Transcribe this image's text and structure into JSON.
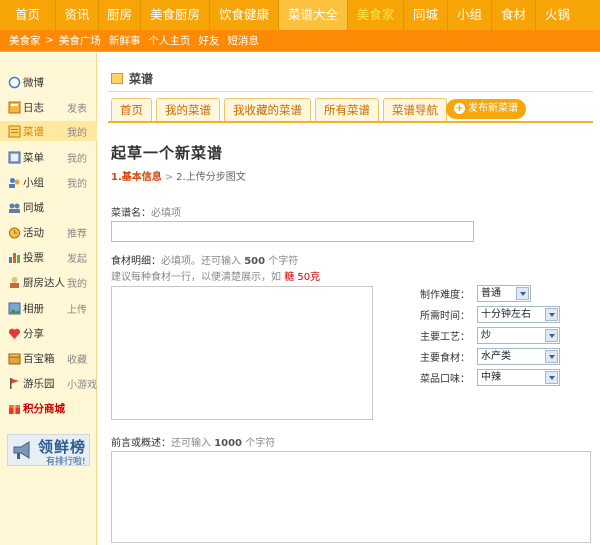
{
  "topnav": {
    "items": [
      {
        "label": "首页",
        "w": 1
      },
      {
        "label": "资讯"
      },
      {
        "label": "厨房"
      },
      {
        "label": "美食厨房"
      },
      {
        "label": "饮食健康"
      },
      {
        "label": "菜谱大全"
      },
      {
        "label": "美食家"
      },
      {
        "label": "同城"
      },
      {
        "label": "小组"
      },
      {
        "label": "食材"
      },
      {
        "label": "火锅"
      }
    ]
  },
  "subnav": {
    "items": [
      "美食家",
      "美食广场",
      "新鲜事",
      "个人主页",
      "好友",
      "短消息"
    ],
    "arrow": ">"
  },
  "sidebar": {
    "items": [
      {
        "label": "微博",
        "sub": ""
      },
      {
        "label": "日志",
        "sub": "发表"
      },
      {
        "label": "菜谱",
        "sub": "我的"
      },
      {
        "label": "菜单",
        "sub": "我的"
      },
      {
        "label": "小组",
        "sub": "我的"
      },
      {
        "label": "同城",
        "sub": ""
      },
      {
        "label": "活动",
        "sub": "推荐"
      },
      {
        "label": "投票",
        "sub": "发起"
      },
      {
        "label": "厨房达人",
        "sub": "我的"
      },
      {
        "label": "相册",
        "sub": "上传"
      },
      {
        "label": "分享",
        "sub": ""
      },
      {
        "label": "百宝箱",
        "sub": "收藏"
      },
      {
        "label": "游乐园",
        "sub": "小游戏"
      },
      {
        "label": "积分商城",
        "sub": ""
      }
    ],
    "banner": {
      "title": "领鲜榜",
      "subtitle": "有排行啦!"
    }
  },
  "main": {
    "section_title": "菜谱",
    "tabs": [
      "首页",
      "我的菜谱",
      "我收藏的菜谱",
      "所有菜谱",
      "菜谱导航"
    ],
    "new_button": "发布新菜谱",
    "heading": "起草一个新菜谱",
    "steps": {
      "step1": "1.基本信息",
      "arrow": ">",
      "step2": "2.上传分步图文"
    }
  },
  "form": {
    "name_label": "菜谱名：",
    "name_hint": "必填项",
    "name_value": "",
    "ingredients_label": "食材明细：",
    "ingredients_hint_pre": "必填项。还可输入",
    "ingredients_hint_count": "500",
    "ingredients_hint_post": "个字符",
    "ingredients_tip": "建议每种食材一行，以便清楚展示，如",
    "ingredients_example": "糖  50克",
    "ingredients_value": "",
    "intro_label": "前言或概述：",
    "intro_hint_pre": "还可输入",
    "intro_hint_count": "1000",
    "intro_hint_post": "个字符",
    "intro_value": "",
    "selects": [
      {
        "label": "制作难度：",
        "value": "普通"
      },
      {
        "label": "所需时间：",
        "value": "十分钟左右"
      },
      {
        "label": "主要工艺：",
        "value": "炒"
      },
      {
        "label": "主要食材：",
        "value": "水产类"
      },
      {
        "label": "菜品口味：",
        "value": "中辣"
      }
    ]
  },
  "colors": {
    "accent": "#f7a506",
    "subnav": "#fd8a05",
    "link": "#c96a00"
  }
}
